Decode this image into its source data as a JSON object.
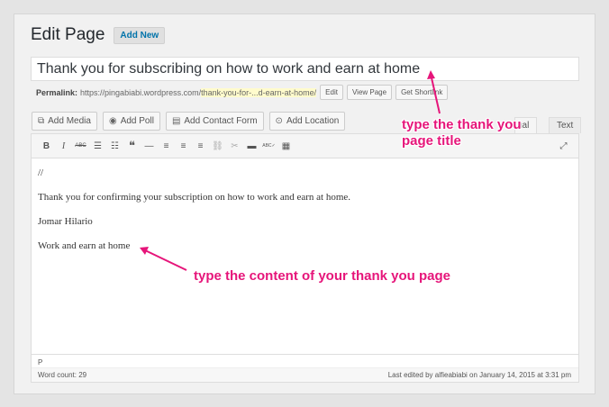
{
  "header": {
    "title": "Edit Page",
    "add_new": "Add New"
  },
  "post_title": {
    "value": "Thank you for subscribing on how to work and earn at home"
  },
  "permalink": {
    "label": "Permalink:",
    "base": "https://pingabiabi.wordpress.com/",
    "slug": "thank-you-for-...d-earn-at-home/",
    "edit": "Edit",
    "view": "View Page",
    "shortlink": "Get Shortlink"
  },
  "media_buttons": [
    {
      "label": "Add Media",
      "icon": "media-icon"
    },
    {
      "label": "Add Poll",
      "icon": "poll-icon"
    },
    {
      "label": "Add Contact Form",
      "icon": "form-icon"
    },
    {
      "label": "Add Location",
      "icon": "location-icon"
    }
  ],
  "tabs": {
    "visual": "ual",
    "text": "Text"
  },
  "toolbar_glyphs": {
    "bold": "B",
    "italic": "I",
    "strike": "ABC",
    "ul": "☰",
    "ol": "☷",
    "quote": "❝",
    "hr": "—",
    "align_left": "≡",
    "align_center": "≡",
    "align_right": "≡",
    "link": "⛓",
    "unlink": "✂",
    "more": "▬",
    "spell": "ABC✓",
    "kitchen": "▦",
    "fullscreen": "⤢"
  },
  "content": {
    "line1": "//",
    "line2": "Thank you for confirming your subscription on how to work and earn at home.",
    "line3": "Jomar Hilario",
    "line4": "Work and earn at home"
  },
  "status": {
    "path": "P",
    "word_count": "Word count: 29",
    "last_edited": "Last edited by alfieabiabi on January 14, 2015 at 3:31 pm"
  },
  "annotations": {
    "title_note_1": "type the thank you",
    "title_note_2": "page title",
    "content_note": "type the content of your thank you page",
    "color": "#e6157a"
  }
}
